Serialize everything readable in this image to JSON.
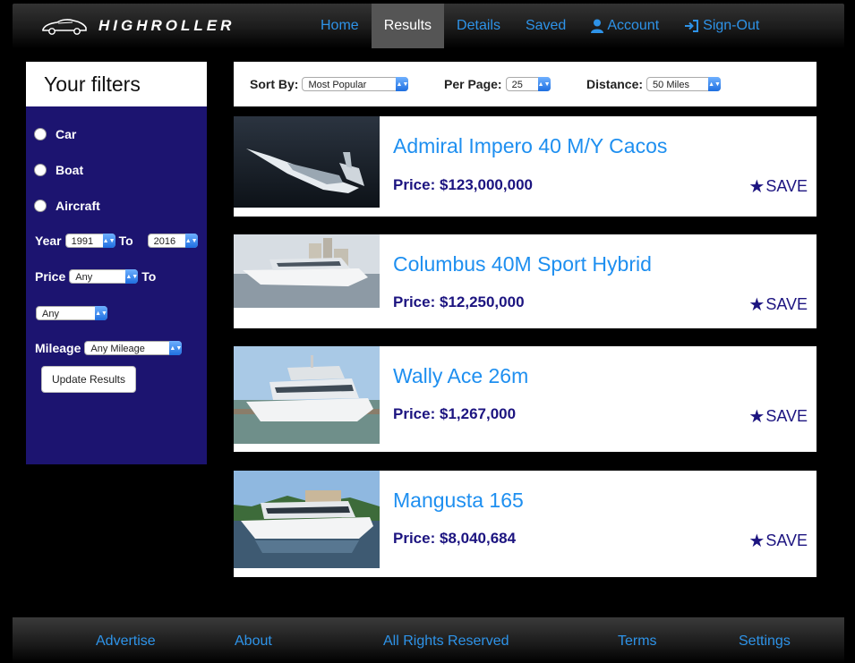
{
  "brand": {
    "name": "HIGHROLLER"
  },
  "nav": {
    "items": [
      {
        "label": "Home",
        "icon": ""
      },
      {
        "label": "Results",
        "icon": ""
      },
      {
        "label": "Details",
        "icon": ""
      },
      {
        "label": "Saved",
        "icon": ""
      },
      {
        "label": "Account",
        "icon": "user-icon"
      },
      {
        "label": "Sign-Out",
        "icon": "sign-out-icon"
      }
    ],
    "active": "Results",
    "accent_color": "#2e93e8"
  },
  "filters": {
    "title": "Your filters",
    "vehicle_types": [
      "Car",
      "Boat",
      "Aircraft"
    ],
    "year_label": "Year",
    "year_from": "1991",
    "to_label": "To",
    "year_to": "2016",
    "price_label": "Price",
    "price_from": "Any",
    "price_to": "Any",
    "mileage_label": "Mileage",
    "mileage_value": "Any Mileage",
    "update_button": "Update Results",
    "panel_color": "#1c1470"
  },
  "sortbar": {
    "sort_label": "Sort By:",
    "sort_value": "Most Popular",
    "per_page_label": "Per Page:",
    "per_page_value": "25",
    "distance_label": "Distance:",
    "distance_value": "50 Miles"
  },
  "results": [
    {
      "title": "Admiral Impero 40 M/Y Cacos",
      "price_label": "Price:",
      "price": "$123,000,000",
      "save_label": "SAVE"
    },
    {
      "title": "Columbus 40M Sport Hybrid",
      "price_label": "Price:",
      "price": "$12,250,000",
      "save_label": "SAVE"
    },
    {
      "title": "Wally Ace 26m",
      "price_label": "Price:",
      "price": "$1,267,000",
      "save_label": "SAVE"
    },
    {
      "title": "Mangusta 165",
      "price_label": "Price:",
      "price": "$8,040,684",
      "save_label": "SAVE"
    }
  ],
  "footer": {
    "links": [
      "Advertise",
      "About",
      "All Rights Reserved",
      "Terms",
      "Settings"
    ]
  }
}
